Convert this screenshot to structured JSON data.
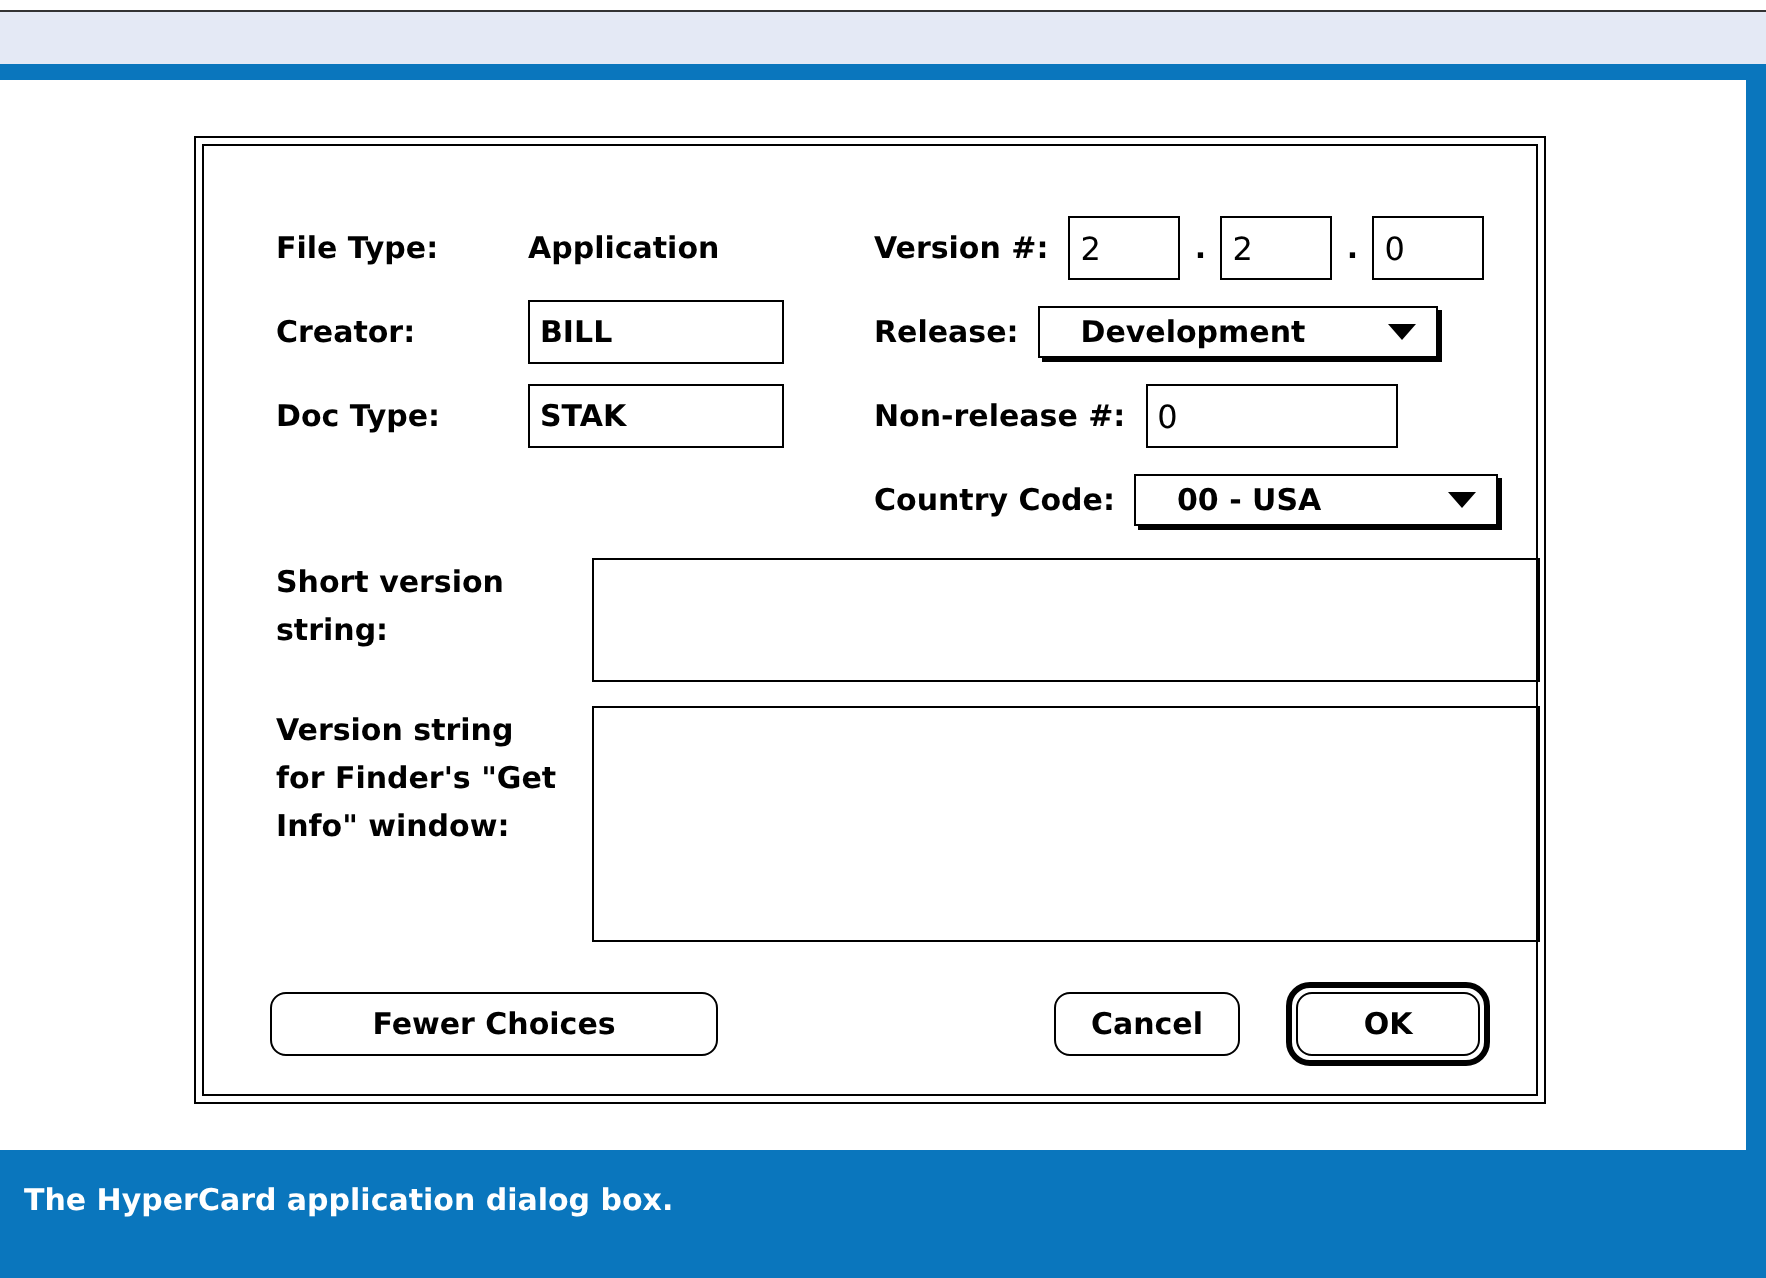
{
  "dialog": {
    "file_type": {
      "label": "File Type:",
      "value": "Application"
    },
    "creator": {
      "label": "Creator:",
      "value": "BILL"
    },
    "doc_type": {
      "label": "Doc Type:",
      "value": "STAK"
    },
    "version": {
      "label": "Version #:",
      "parts": [
        "2",
        "2",
        "0"
      ],
      "separators": [
        ".",
        "."
      ]
    },
    "release": {
      "label": "Release:",
      "value": "Development"
    },
    "non_release": {
      "label": "Non-release #:",
      "value": "0"
    },
    "country_code": {
      "label": "Country Code:",
      "value": "00 - USA"
    },
    "short_version": {
      "label": "Short version string:"
    },
    "finder_version": {
      "label": "Version string for Finder's \"Get Info\" window:"
    },
    "buttons": [
      {
        "label": "Fewer Choices",
        "default": false
      },
      {
        "label": "Cancel",
        "default": false
      },
      {
        "label": "OK",
        "default": true
      }
    ]
  },
  "caption": "The HyperCard application dialog box."
}
